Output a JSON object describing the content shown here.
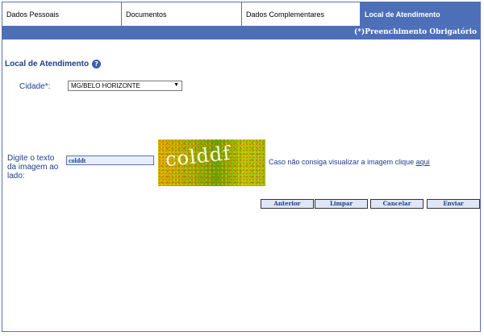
{
  "tabs": [
    {
      "label": "Dados Pessoais",
      "active": false
    },
    {
      "label": "Documentos",
      "active": false
    },
    {
      "label": "Dados Complementares",
      "active": false
    },
    {
      "label": "Local de Atendimento",
      "active": true
    }
  ],
  "header": {
    "required_note": "(*)Preenchimento Obrigatório"
  },
  "section": {
    "title": "Local de Atendimento",
    "help_icon": "question-circle"
  },
  "city": {
    "label": "Cidade*:",
    "selected": "MG/BELO HORIZONTE"
  },
  "captcha": {
    "label": "Digite o texto da imagem ao lado:",
    "input_value": "colddt",
    "image_text": "colddf",
    "fallback_text": "Caso não consiga visualizar a imagem clique",
    "fallback_link": "aqui"
  },
  "buttons": {
    "previous": "Anterior",
    "clear": "Limpar",
    "cancel": "Cancelar",
    "send": "Enviar"
  },
  "colors": {
    "accent": "#4d6fb8",
    "text": "#1e3d8a"
  }
}
